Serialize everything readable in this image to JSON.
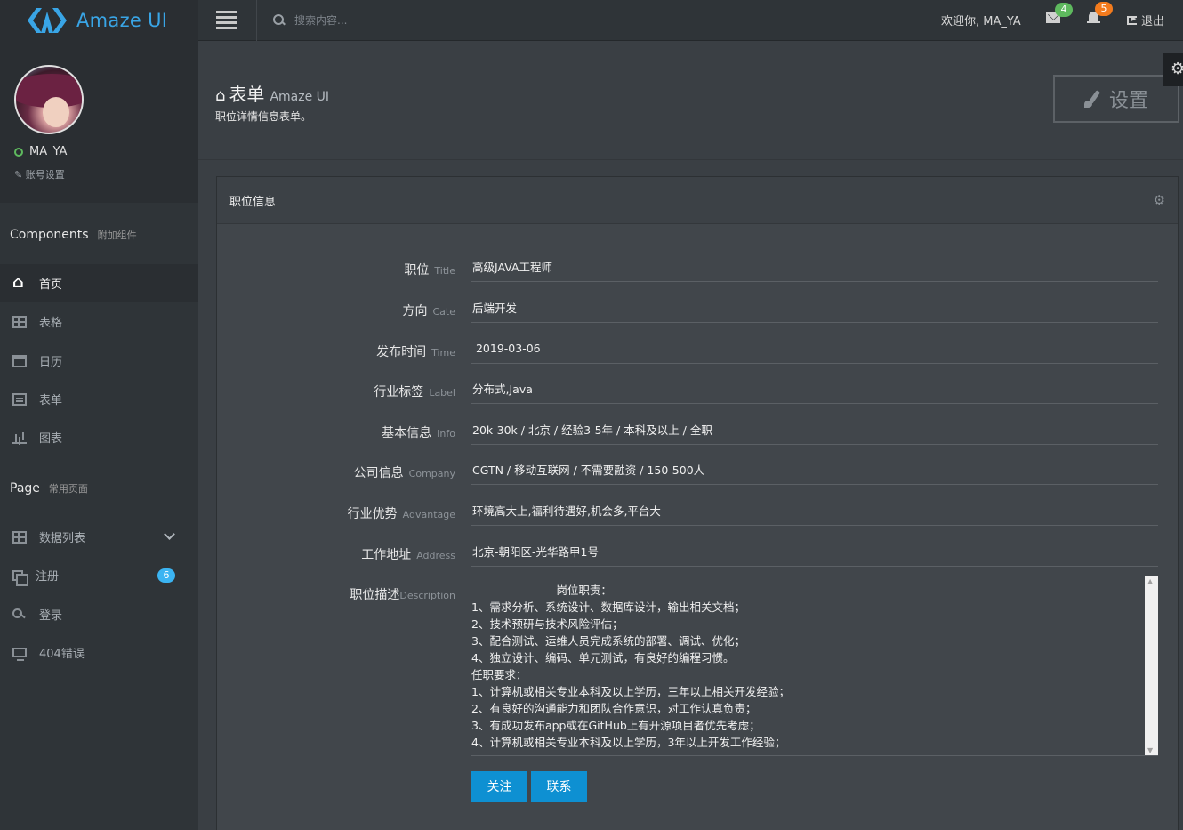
{
  "app": {
    "logo_text": "Amaze UI"
  },
  "topbar": {
    "search_placeholder": "搜索内容...",
    "welcome": "欢迎你, MA_YA",
    "mail_count": "4",
    "notify_count": "5",
    "logout": "退出"
  },
  "sidebar": {
    "username": "MA_YA",
    "account_settings": "账号设置",
    "components": {
      "title": "Components",
      "sub": "附加组件"
    },
    "component_items": [
      {
        "label": "首页",
        "icon": "home-icon"
      },
      {
        "label": "表格",
        "icon": "table-icon"
      },
      {
        "label": "日历",
        "icon": "calendar-icon"
      },
      {
        "label": "表单",
        "icon": "form-icon"
      },
      {
        "label": "图表",
        "icon": "chart-icon"
      }
    ],
    "page": {
      "title": "Page",
      "sub": "常用页面"
    },
    "page_items": [
      {
        "label": "数据列表",
        "icon": "table-icon"
      },
      {
        "label": "注册",
        "icon": "copy-icon",
        "badge": "6"
      },
      {
        "label": "登录",
        "icon": "key-icon"
      },
      {
        "label": "404错误",
        "icon": "monitor-icon"
      }
    ]
  },
  "header": {
    "title": "表单",
    "title_sub": "Amaze UI",
    "description": "职位详情信息表单。",
    "settings_button": "设置"
  },
  "panel": {
    "title": "职位信息",
    "fields": [
      {
        "label": "职位",
        "en": "Title",
        "value": "高级JAVA工程师"
      },
      {
        "label": "方向",
        "en": "Cate",
        "value": "后端开发"
      },
      {
        "label": "发布时间",
        "en": "Time",
        "value": " 2019-03-06"
      },
      {
        "label": "行业标签",
        "en": "Label",
        "value": "分布式,Java"
      },
      {
        "label": "基本信息",
        "en": "Info",
        "value": "20k-30k / 北京 / 经验3-5年 / 本科及以上 / 全职"
      },
      {
        "label": "公司信息",
        "en": "Company",
        "value": "CGTN / 移动互联网 / 不需要融资 / 150-500人"
      },
      {
        "label": "行业优势",
        "en": "Advantage",
        "value": "环境高大上,福利待遇好,机会多,平台大"
      },
      {
        "label": "工作地址",
        "en": "Address",
        "value": "北京-朝阳区-光华路甲1号"
      }
    ],
    "description": {
      "label": "职位描述",
      "en": "Description",
      "text": "                        岗位职责：\n1、需求分析、系统设计、数据库设计，输出相关文档；\n2、技术预研与技术风险评估；\n3、配合测试、运维人员完成系统的部署、调试、优化；\n4、独立设计、编码、单元测试，有良好的编程习惯。\n任职要求：\n1、计算机或相关专业本科及以上学历，三年以上相关开发经验；\n2、有良好的沟通能力和团队合作意识，对工作认真负责；\n3、有成功发布app或在GitHub上有开源项目者优先考虑；\n4、计算机或相关专业本科及以上学历，3年以上开发工作经验；"
    },
    "buttons": {
      "follow": "关注",
      "contact": "联系"
    }
  },
  "colors": {
    "accent": "#0e90d2",
    "logo": "#39a5e6",
    "badge_green": "#5eb95e",
    "badge_orange": "#f37b1d",
    "badge_blue": "#3bb4f2"
  }
}
